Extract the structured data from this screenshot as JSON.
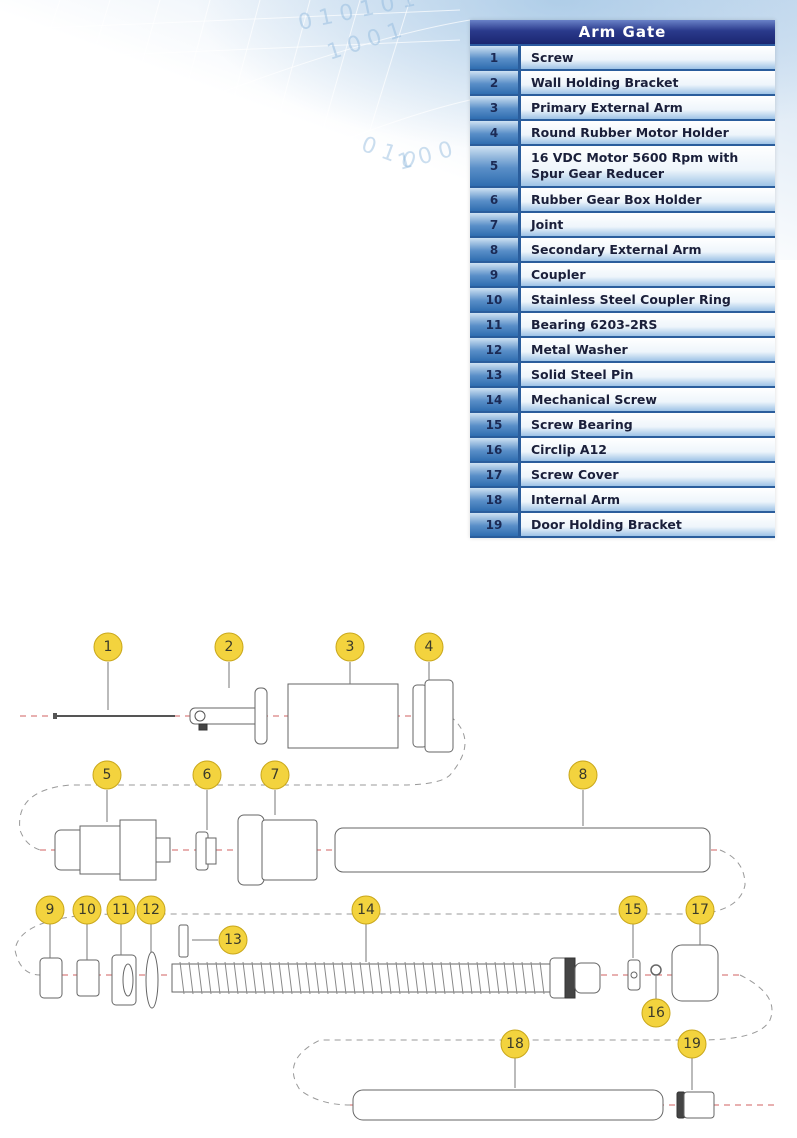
{
  "table": {
    "title": "Arm Gate",
    "rows": [
      {
        "num": "1",
        "label": "Screw"
      },
      {
        "num": "2",
        "label": "Wall Holding Bracket"
      },
      {
        "num": "3",
        "label": "Primary External Arm"
      },
      {
        "num": "4",
        "label": "Round Rubber Motor Holder"
      },
      {
        "num": "5",
        "label": "16 VDC Motor 5600 Rpm with Spur Gear Reducer"
      },
      {
        "num": "6",
        "label": "Rubber Gear Box Holder"
      },
      {
        "num": "7",
        "label": "Joint"
      },
      {
        "num": "8",
        "label": "Secondary External Arm"
      },
      {
        "num": "9",
        "label": "Coupler"
      },
      {
        "num": "10",
        "label": "Stainless Steel Coupler Ring"
      },
      {
        "num": "11",
        "label": "Bearing 6203-2RS"
      },
      {
        "num": "12",
        "label": "Metal Washer"
      },
      {
        "num": "13",
        "label": "Solid Steel Pin"
      },
      {
        "num": "14",
        "label": "Mechanical Screw"
      },
      {
        "num": "15",
        "label": "Screw Bearing"
      },
      {
        "num": "16",
        "label": "Circlip A12"
      },
      {
        "num": "17",
        "label": "Screw Cover"
      },
      {
        "num": "18",
        "label": "Internal Arm"
      },
      {
        "num": "19",
        "label": "Door Holding Bracket"
      }
    ]
  },
  "diagram": {
    "callouts": [
      "1",
      "2",
      "3",
      "4",
      "5",
      "6",
      "7",
      "8",
      "9",
      "10",
      "11",
      "12",
      "13",
      "14",
      "15",
      "16",
      "17",
      "18",
      "19"
    ]
  },
  "colors": {
    "callout_fill": "#f3d33e",
    "header_blue": "#1b2670",
    "row_border": "#2a5d9c"
  }
}
